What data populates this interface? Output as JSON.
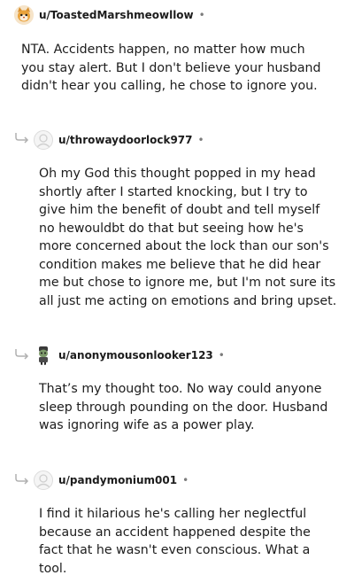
{
  "comments": [
    {
      "username": "u/ToastedMarshmeowllow",
      "separator": "•",
      "avatar": "cat-avatar-icon",
      "body": "NTA. Accidents happen, no matter how much you stay alert. But I don't believe your husband didn't hear you calling, he chose to ignore you."
    },
    {
      "username": "u/throwaydoorlock977",
      "separator": "•",
      "avatar": "default-avatar-icon",
      "body": "Oh my God this thought popped in my head shortly after I started knocking, but I try to give him the benefit of doubt and tell myself no hewouldbt do that but seeing how he's more concerned about the lock than our son's condition makes me believe that he did hear me but chose to ignore me, but I'm not sure its all just me acting on emotions and bring upset."
    },
    {
      "username": "u/anonymousonlooker123",
      "separator": "•",
      "avatar": "character-avatar-icon",
      "body": "That’s my thought too. No way could anyone sleep through pounding on the door. Husband was ignoring wife as a power play."
    },
    {
      "username": "u/pandymonium001",
      "separator": "•",
      "avatar": "default-avatar-icon",
      "body": "I find it hilarious he's calling her neglectful because an accident happened despite the fact that he wasn't even conscious. What a tool."
    }
  ],
  "colors": {
    "text": "#1c1c1c",
    "meta": "#7c7c7c",
    "reply_line": "#b0b0b0"
  }
}
